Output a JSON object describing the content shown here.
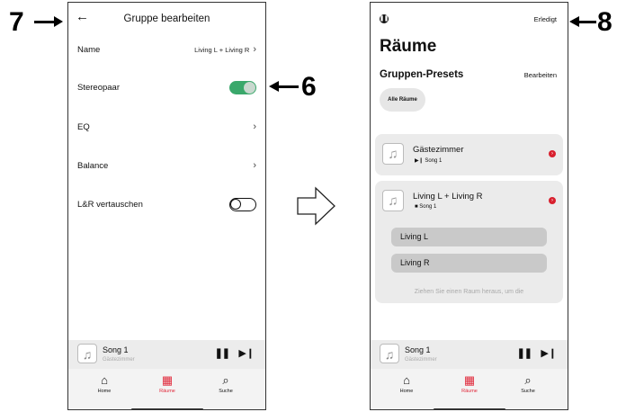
{
  "callouts": {
    "left": "7",
    "middle": "6",
    "right": "8"
  },
  "left_screen": {
    "title": "Gruppe bearbeiten",
    "back_icon": "arrow-left-icon",
    "rows": {
      "name_label": "Name",
      "name_value": "Living L + Living R",
      "stereo_label": "Stereopaar",
      "eq_label": "EQ",
      "balance_label": "Balance",
      "swap_label": "L&R vertauschen"
    },
    "toggles": {
      "stereo_on": true,
      "swap_on": false
    }
  },
  "right_screen": {
    "done_label": "Erledigt",
    "title": "Räume",
    "presets_title": "Gruppen-Presets",
    "edit_label": "Bearbeiten",
    "chip_label": "Alle Räume",
    "rooms": [
      {
        "name": "Gästezimmer",
        "song": "Song 1",
        "state_icon": "play-pause-icon"
      },
      {
        "name": "Living L + Living R",
        "song": "Song 1",
        "state_icon": "stop-icon"
      }
    ],
    "members": [
      "Living L",
      "Living R"
    ],
    "hint": "Ziehen Sie einen Raum heraus, um die"
  },
  "now_playing": {
    "title": "Song 1",
    "subtitle": "Gästezimmer"
  },
  "tabs": {
    "home": "Home",
    "rooms": "Räume",
    "search": "Suche"
  },
  "colors": {
    "accent_red": "#e0283a",
    "toggle_green": "#3aa86b"
  }
}
